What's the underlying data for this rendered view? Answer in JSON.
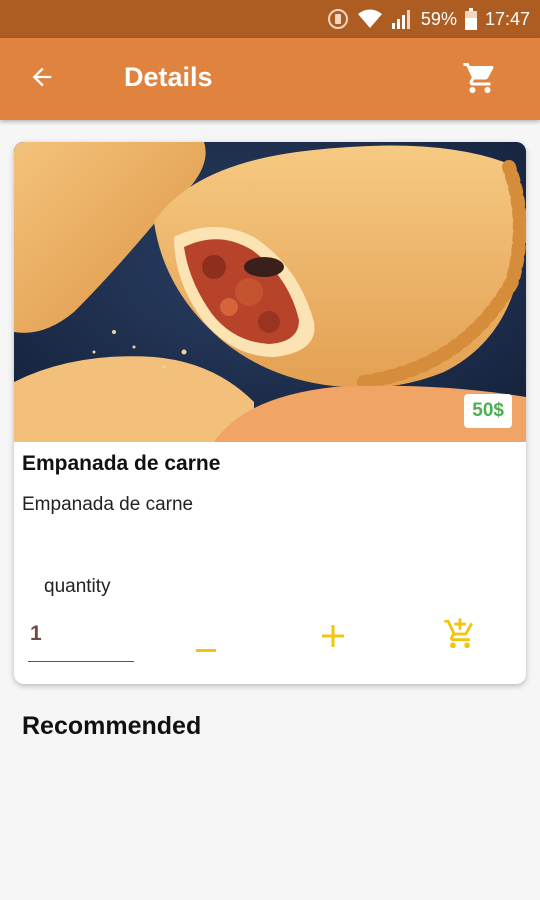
{
  "status_bar": {
    "battery": "59%",
    "time": "17:47"
  },
  "app_bar": {
    "title": "Details"
  },
  "product": {
    "price": "50$",
    "name": "Empanada de carne",
    "description": "Empanada de carne",
    "quantity_label": "quantity",
    "quantity_value": "1"
  },
  "section": {
    "recommended_title": "Recommended"
  },
  "colors": {
    "status_bar": "#ad5d22",
    "app_bar": "#e0833f",
    "accent": "#f2c40f",
    "price": "#4caf50"
  },
  "icons": {
    "back": "arrow-left-icon",
    "cart": "shopping-cart-icon",
    "decrement": "minus-icon",
    "increment": "plus-icon",
    "add_to_cart": "cart-plus-icon"
  }
}
